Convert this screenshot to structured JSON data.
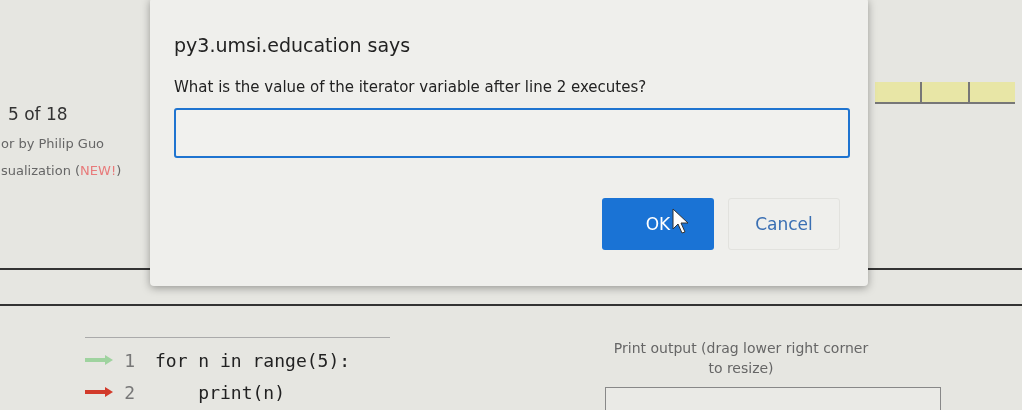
{
  "page": {
    "step_counter": "5 of 18",
    "author_credit": "or by Philip Guo",
    "visualization_link": {
      "text": "sualization (",
      "badge": "NEW!",
      "close": ")"
    }
  },
  "code": {
    "lines": [
      {
        "number": "1",
        "text": "for n in range(5):",
        "next_line": false
      },
      {
        "number": "2",
        "text": "    print(n)",
        "next_line": true
      }
    ]
  },
  "output": {
    "label": "Print output (drag lower right corner to resize)"
  },
  "dialog": {
    "title": "py3.umsi.education says",
    "message": "What is the value of the iterator variable after line 2 executes?",
    "buttons": [
      {
        "label": "OK",
        "kind": "primary"
      },
      {
        "label": "Cancel",
        "kind": "secondary"
      }
    ]
  }
}
